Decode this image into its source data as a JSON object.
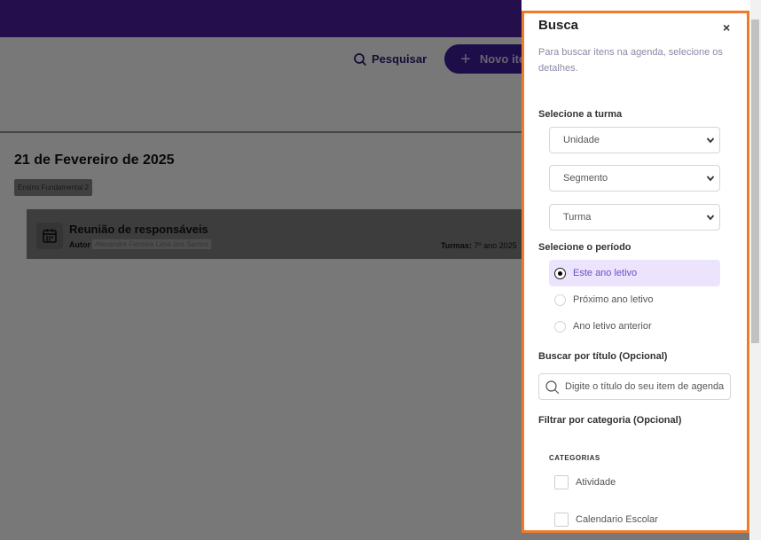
{
  "header": {
    "search_label": "Pesquisar",
    "new_item_label": "Novo iten"
  },
  "agenda": {
    "date_title": "21 de Fevereiro de 2025",
    "level_tag": "Ensino Fundamental 2",
    "event": {
      "title": "Reunião de responsáveis",
      "author_label": "Autor",
      "author_name": "Alexandre Ferreira Lima dos Santos",
      "classes_label": "Turmas:",
      "classes_value": "7º ano 2025"
    }
  },
  "drawer": {
    "title": "Busca",
    "close_label": "×",
    "hint": "Para buscar itens na agenda, selecione os detalhes.",
    "class_section_label": "Selecione a turma",
    "selects": {
      "unit": "Unidade",
      "segment": "Segmento",
      "class": "Turma"
    },
    "period_section_label": "Selecione o período",
    "periods": [
      "Este ano letivo",
      "Próximo ano letivo",
      "Ano letivo anterior"
    ],
    "selected_period": "Este ano letivo",
    "title_search_label": "Buscar por título (Opcional)",
    "title_search_placeholder": "Digite o título do seu item de agenda",
    "category_filter_label": "Filtrar por categoria (Opcional)",
    "categories_header": "CATEGORIAS",
    "categories": [
      "Atividade",
      "Calendario Escolar"
    ]
  },
  "colors": {
    "topbar": "#4a1d99",
    "accent": "#3a1a92",
    "drawer_border": "#f07a2b",
    "selected_bg": "#ece4fd",
    "selected_text": "#6b4fc8"
  }
}
